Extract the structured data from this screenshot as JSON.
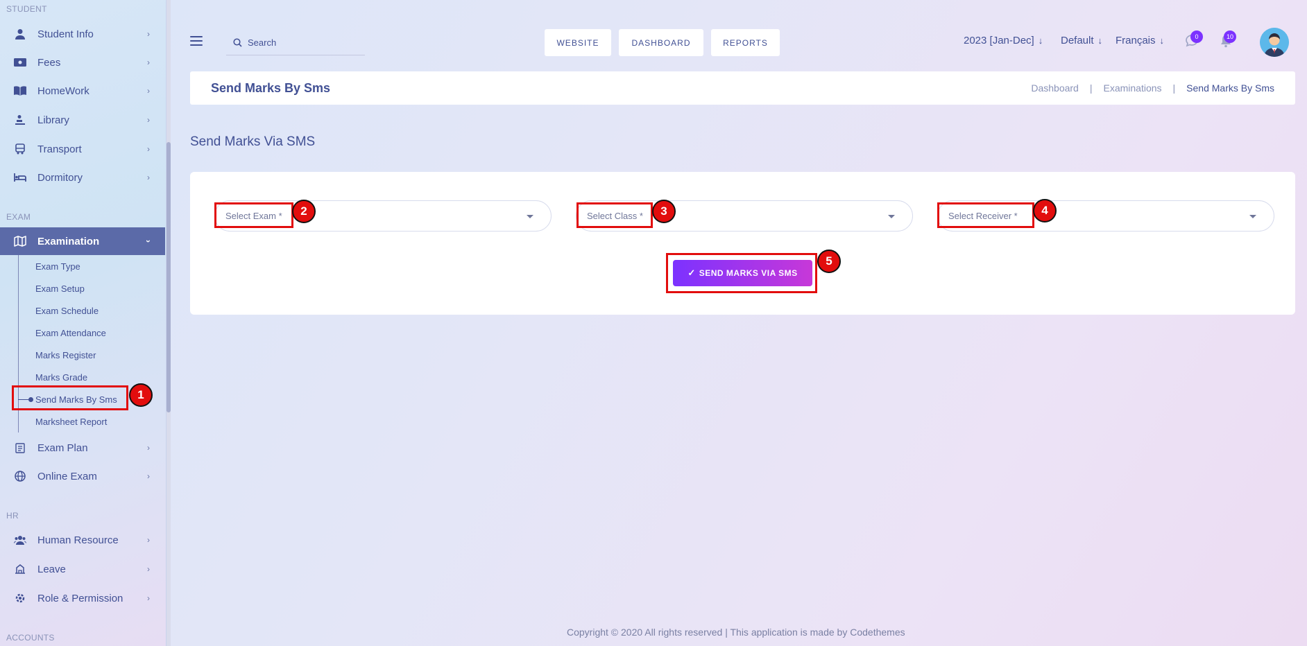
{
  "sidebar": {
    "section_student": "STUDENT",
    "section_exam": "EXAM",
    "section_hr": "HR",
    "section_accounts": "ACCOUNTS",
    "student_items": [
      {
        "label": "Student Info",
        "icon": "student-icon"
      },
      {
        "label": "Fees",
        "icon": "money-icon"
      },
      {
        "label": "HomeWork",
        "icon": "book-icon"
      },
      {
        "label": "Library",
        "icon": "library-icon"
      },
      {
        "label": "Transport",
        "icon": "bus-icon"
      },
      {
        "label": "Dormitory",
        "icon": "bed-icon"
      }
    ],
    "examination": {
      "label": "Examination",
      "icon": "map-icon"
    },
    "exam_subitems": [
      "Exam Type",
      "Exam Setup",
      "Exam Schedule",
      "Exam Attendance",
      "Marks Register",
      "Marks Grade",
      "Send Marks By Sms",
      "Marksheet Report"
    ],
    "exam_items": [
      {
        "label": "Exam Plan",
        "icon": "clipboard-icon"
      },
      {
        "label": "Online Exam",
        "icon": "globe-icon"
      }
    ],
    "hr_items": [
      {
        "label": "Human Resource",
        "icon": "users-icon"
      },
      {
        "label": "Leave",
        "icon": "leave-icon"
      },
      {
        "label": "Role & Permission",
        "icon": "gear-icon"
      }
    ]
  },
  "header": {
    "search_placeholder": "Search",
    "buttons": [
      "WEBSITE",
      "DASHBOARD",
      "REPORTS"
    ],
    "session": "2023 [Jan-Dec]",
    "default": "Default",
    "language": "Français",
    "messages_count": "0",
    "notifications_count": "10"
  },
  "page": {
    "title": "Send Marks By Sms",
    "breadcrumb": [
      "Dashboard",
      "Examinations",
      "Send Marks By Sms"
    ],
    "section_title": "Send Marks Via SMS"
  },
  "form": {
    "select_exam": "Select Exam *",
    "select_class": "Select Class *",
    "select_receiver": "Select Receiver *",
    "submit_label": "SEND MARKS VIA SMS"
  },
  "annotations": [
    "1",
    "2",
    "3",
    "4",
    "5"
  ],
  "footer": "Copyright © 2020 All rights reserved | This application is made by Codethemes",
  "colors": {
    "accent": "#7c32ff",
    "accent_end": "#c738d8",
    "primary_text": "#415094",
    "active_nav": "#5b6aa8",
    "annotation": "#e20d0d"
  }
}
